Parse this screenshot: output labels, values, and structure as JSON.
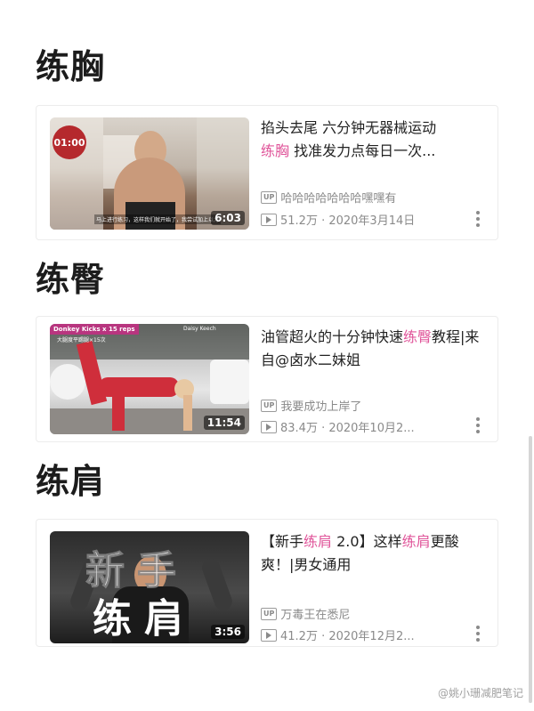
{
  "sections": [
    {
      "title": "练胸",
      "video": {
        "title_parts": [
          "掐头去尾 六分钟无器械运动",
          "练胸",
          " 找准发力点每日一次..."
        ],
        "uploader": "哈哈哈哈哈哈哈嘿嘿有",
        "stats": "51.2万 · 2020年3月14日",
        "duration": "6:03",
        "overlay_timer": "01:00",
        "overlay_caption": "马上进行练习，这样我们就开始了，我尝试加上以力"
      }
    },
    {
      "title": "练臀",
      "video": {
        "title_parts": [
          "油管超火的十分钟快速",
          "练臀",
          "教程|来自@卤水二妹姐"
        ],
        "uploader": "我要成功上岸了",
        "stats": "83.4万 · 2020年10月2...",
        "duration": "11:54",
        "overlay_tag": "Donkey Kicks x 15 reps",
        "overlay_sub": "大腿度平踢腿×15次",
        "overlay_right": "Daisy Keech"
      }
    },
    {
      "title": "练肩",
      "video": {
        "title_parts": [
          "【新手",
          "练肩",
          " 2.0】这样",
          "练肩",
          "更酸爽！|男女通用"
        ],
        "uploader": "万毒王在悉尼",
        "stats": "41.2万 · 2020年12月2...",
        "duration": "3:56",
        "overlay_top": "新手",
        "overlay_bottom": "练肩"
      }
    }
  ],
  "up_label": "UP",
  "watermark": "@姚小珊减肥笔记",
  "colors": {
    "highlight": "#e0559a",
    "meta": "#8a8a8a"
  }
}
